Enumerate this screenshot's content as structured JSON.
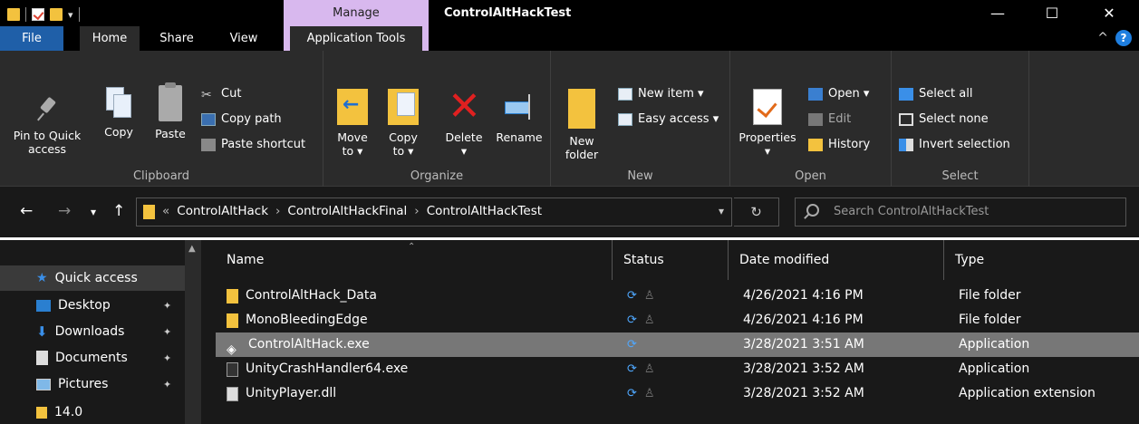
{
  "titlebar": {
    "manage_label": "Manage",
    "window_title": "ControlAltHackTest",
    "minimize": "—",
    "maximize": "☐",
    "close": "✕"
  },
  "tabs": {
    "file": "File",
    "home": "Home",
    "share": "Share",
    "view": "View",
    "app_tools": "Application Tools",
    "collapse": "^",
    "help": "?"
  },
  "ribbon": {
    "clipboard": {
      "label": "Clipboard",
      "pin_line1": "Pin to Quick",
      "pin_line2": "access",
      "copy": "Copy",
      "paste": "Paste",
      "cut": "Cut",
      "copy_path": "Copy path",
      "paste_shortcut": "Paste shortcut"
    },
    "organize": {
      "label": "Organize",
      "move_line1": "Move",
      "move_line2": "to ▾",
      "copy_line1": "Copy",
      "copy_line2": "to ▾",
      "delete_line1": "Delete",
      "delete_line2": "▾",
      "rename": "Rename"
    },
    "new": {
      "label": "New",
      "new_folder_line1": "New",
      "new_folder_line2": "folder",
      "new_item": "New item ▾",
      "easy_access": "Easy access ▾"
    },
    "open": {
      "label": "Open",
      "properties_line1": "Properties",
      "properties_line2": "▾",
      "open": "Open ▾",
      "edit": "Edit",
      "history": "History"
    },
    "select": {
      "label": "Select",
      "select_all": "Select all",
      "select_none": "Select none",
      "invert_selection": "Invert selection"
    }
  },
  "address": {
    "back": "←",
    "forward": "→",
    "recent": "▾",
    "up": "↑",
    "overflow": "«",
    "crumbs": [
      "ControlAltHack",
      "ControlAltHackFinal",
      "ControlAltHackTest"
    ],
    "separator": "›",
    "dropdown": "▾",
    "refresh": "↻",
    "search_placeholder": "Search ControlAltHackTest"
  },
  "navpane": {
    "items": [
      {
        "label": "Quick access",
        "icon": "star-icon"
      },
      {
        "label": "Desktop",
        "icon": "desktop-icon",
        "pin": "📌"
      },
      {
        "label": "Downloads",
        "icon": "download-icon",
        "pin": "📌"
      },
      {
        "label": "Documents",
        "icon": "documents-icon",
        "pin": "📌"
      },
      {
        "label": "Pictures",
        "icon": "pictures-icon",
        "pin": "📌"
      },
      {
        "label": "14.0",
        "icon": "folder-icon"
      }
    ]
  },
  "filelist": {
    "columns": {
      "name": "Name",
      "status": "Status",
      "date": "Date modified",
      "type": "Type"
    },
    "rows": [
      {
        "name": "ControlAltHack_Data",
        "status": "⟳",
        "date": "4/26/2021 4:16 PM",
        "type": "File folder",
        "icon": "folder-icon",
        "selected": false
      },
      {
        "name": "MonoBleedingEdge",
        "status": "⟳",
        "date": "4/26/2021 4:16 PM",
        "type": "File folder",
        "icon": "folder-icon",
        "selected": false
      },
      {
        "name": "ControlAltHack.exe",
        "status": "⟳",
        "date": "3/28/2021 3:51 AM",
        "type": "Application",
        "icon": "unity-icon",
        "selected": true
      },
      {
        "name": "UnityCrashHandler64.exe",
        "status": "⟳",
        "date": "3/28/2021 3:52 AM",
        "type": "Application",
        "icon": "exe-icon",
        "selected": false
      },
      {
        "name": "UnityPlayer.dll",
        "status": "⟳",
        "date": "3/28/2021 3:52 AM",
        "type": "Application extension",
        "icon": "dll-icon",
        "selected": false
      }
    ]
  },
  "colors": {
    "accent": "#1f5fa8",
    "manage": "#d8b8ee",
    "folder": "#f3c23e",
    "delete": "#e02020",
    "selected_row": "#777777"
  }
}
